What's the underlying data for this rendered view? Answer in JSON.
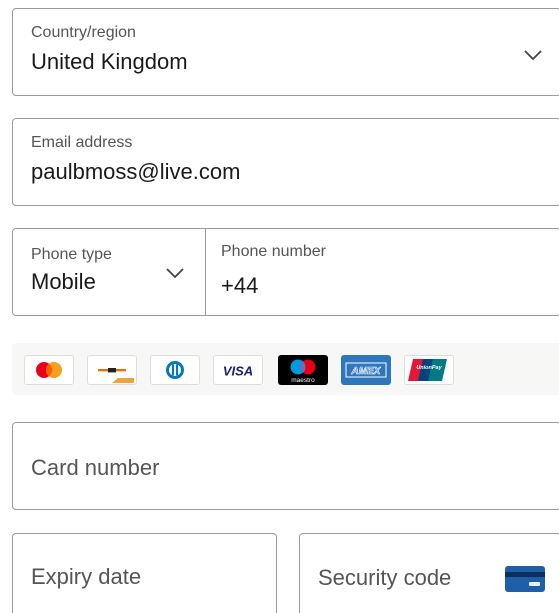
{
  "country": {
    "label": "Country/region",
    "value": "United Kingdom",
    "icon": "chevron-down-icon"
  },
  "email": {
    "label": "Email address",
    "value": "paulbmoss@live.com"
  },
  "phone_type": {
    "label": "Phone type",
    "value": "Mobile",
    "icon": "chevron-down-icon"
  },
  "phone_number": {
    "label": "Phone number",
    "value": "+44"
  },
  "card_brands": {
    "visa": "VISA",
    "maestro": "maestro",
    "amex": "AMEX",
    "unionpay": "UnionPay"
  },
  "card_number": {
    "placeholder": "Card number"
  },
  "expiry": {
    "placeholder": "Expiry date"
  },
  "security": {
    "placeholder": "Security code",
    "icon": "card-back-icon"
  },
  "colors": {
    "border": "#9a9a9a",
    "amex": "#2e77bc",
    "visa": "#1a1f71",
    "mastercard_red": "#eb001b",
    "mastercard_orange": "#f79e1b"
  }
}
